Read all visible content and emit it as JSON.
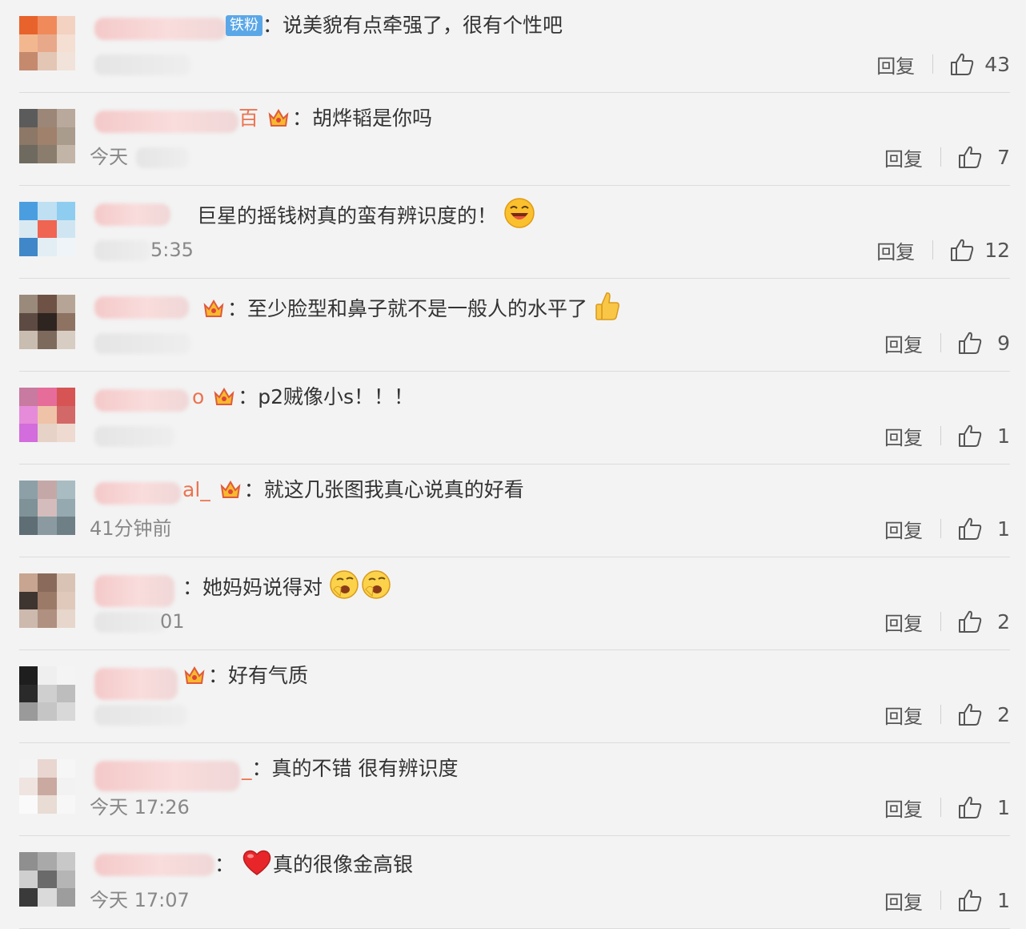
{
  "colors": {
    "background": "#f3f3f3",
    "name_accent": "#eb7350",
    "badge_blue": "#5aa7e8",
    "divider": "#dcdcdc"
  },
  "comments": [
    {
      "badge": "铁粉",
      "name_tail": "",
      "text": "：说美貌有点牵强了，很有个性吧",
      "time": "",
      "reply_label": "回复",
      "likes": "43"
    },
    {
      "name_tail": "百",
      "text": "：胡烨韬是你吗",
      "time": "今天",
      "reply_label": "回复",
      "likes": "7"
    },
    {
      "name_tail": "",
      "text": "巨星的摇钱树真的蛮有辨识度的！",
      "time": "5:35",
      "reply_label": "回复",
      "likes": "12"
    },
    {
      "name_tail": "",
      "text": "：至少脸型和鼻子就不是一般人的水平了",
      "time": "",
      "reply_label": "回复",
      "likes": "9"
    },
    {
      "name_tail": "o",
      "text": "：p2贼像小s！！！",
      "time": "",
      "reply_label": "回复",
      "likes": "1"
    },
    {
      "name_tail": "al_",
      "text": "：就这几张图我真心说真的好看",
      "time": "41分钟前",
      "reply_label": "回复",
      "likes": "1"
    },
    {
      "name_tail": "",
      "text": "：她妈妈说得对",
      "time": "01",
      "reply_label": "回复",
      "likes": "2"
    },
    {
      "name_tail": "",
      "text": "：好有气质",
      "time": "",
      "reply_label": "回复",
      "likes": "2"
    },
    {
      "name_tail": "_",
      "text": "：真的不错 很有辨识度",
      "time": "今天 17:26",
      "reply_label": "回复",
      "likes": "1"
    },
    {
      "name_tail": "",
      "text": "：",
      "text2": "真的很像金高银",
      "time": "今天 17:07",
      "reply_label": "回复",
      "likes": "1"
    }
  ]
}
